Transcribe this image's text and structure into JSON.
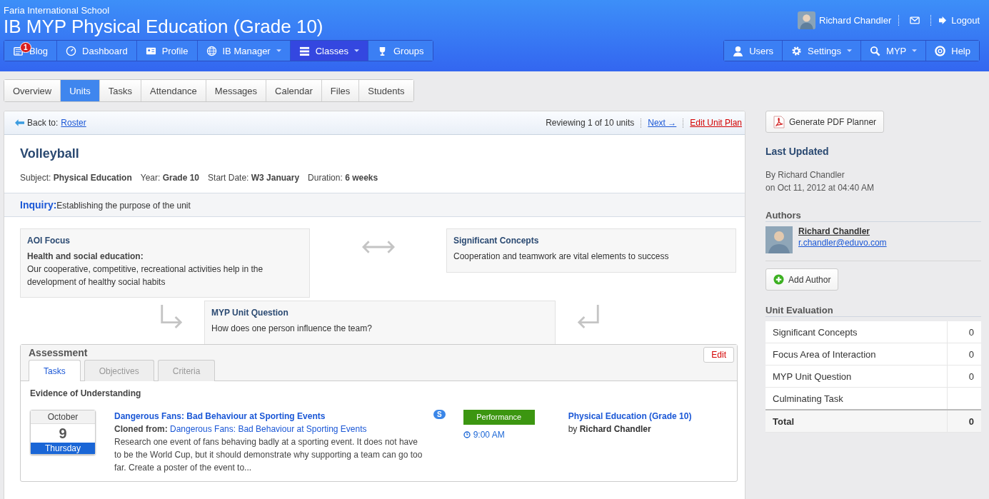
{
  "header": {
    "school": "Faria International School",
    "title": "IB MYP Physical Education (Grade 10)",
    "user": "Richard Chandler",
    "logout": "Logout"
  },
  "nav_left": [
    {
      "label": "Blog",
      "badge": "1",
      "caret": false,
      "selected": false
    },
    {
      "label": "Dashboard",
      "caret": false,
      "selected": false
    },
    {
      "label": "Profile",
      "caret": false,
      "selected": false
    },
    {
      "label": "IB Manager",
      "caret": true,
      "selected": false
    },
    {
      "label": "Classes",
      "caret": true,
      "selected": true
    },
    {
      "label": "Groups",
      "caret": false,
      "selected": false
    }
  ],
  "nav_right": [
    {
      "label": "Users",
      "caret": false
    },
    {
      "label": "Settings",
      "caret": true
    },
    {
      "label": "MYP",
      "caret": true
    },
    {
      "label": "Help",
      "caret": false
    }
  ],
  "tabs": [
    {
      "label": "Overview",
      "selected": false
    },
    {
      "label": "Units",
      "selected": true
    },
    {
      "label": "Tasks",
      "selected": false
    },
    {
      "label": "Attendance",
      "selected": false
    },
    {
      "label": "Messages",
      "selected": false
    },
    {
      "label": "Calendar",
      "selected": false
    },
    {
      "label": "Files",
      "selected": false
    },
    {
      "label": "Students",
      "selected": false
    }
  ],
  "unit": {
    "back_label": "Back to:",
    "back_link": "Roster",
    "reviewing": "Reviewing 1 of 10 units",
    "next": "Next →",
    "edit_plan": "Edit Unit Plan",
    "title": "Volleyball",
    "meta": [
      "Subject: **Physical Education**",
      "Year: **Grade 10**",
      "Start Date: **W3 January**",
      "Duration: **6 weeks**"
    ],
    "inquiry_label": "Inquiry:",
    "inquiry_text": "Establishing the purpose of the unit",
    "aoi": {
      "title": "AOI Focus",
      "subtitle": "Health and social education:",
      "text": "Our cooperative, competitive, recreational activities help in the development of healthy social habits"
    },
    "concepts": {
      "title": "Significant Concepts",
      "text": "Cooperation and teamwork are vital elements to success"
    },
    "question": {
      "title": "MYP Unit Question",
      "text": "How does one person influence the team?"
    }
  },
  "assessment": {
    "title": "Assessment",
    "edit": "Edit",
    "tabs": [
      {
        "label": "Tasks",
        "selected": true
      },
      {
        "label": "Objectives",
        "selected": false
      },
      {
        "label": "Criteria",
        "selected": false
      }
    ],
    "heading": "Evidence of Understanding",
    "tasks": [
      {
        "month": "October",
        "day": "9",
        "weekday": "Thursday",
        "title": "Dangerous Fans: Bad Behaviour at Sporting Events",
        "cloned_label": "Cloned from:",
        "cloned_link": "Dangerous Fans: Bad Behaviour at Sporting Events",
        "description": "Research one event of fans behaving badly at a sporting event. It does not have to be the World Cup, but it should demonstrate why supporting a team can go too far. Create a poster of the event to...",
        "badge": "S",
        "type": "Performance",
        "time": "9:00 AM",
        "class": "Physical Education (Grade 10)",
        "by": "by **Richard Chandler**"
      }
    ]
  },
  "sidebar": {
    "pdf_button": "Generate PDF Planner",
    "updated_title": "Last Updated",
    "updated_by": "By Richard Chandler",
    "updated_on": "on Oct 11, 2012 at 04:40 AM",
    "authors_title": "Authors",
    "authors": [
      {
        "name": "Richard Chandler",
        "email": "r.chandler@eduvo.com"
      }
    ],
    "add_author": "Add Author",
    "evaluation_title": "Unit Evaluation",
    "evaluation": [
      {
        "label": "Significant Concepts",
        "value": "0"
      },
      {
        "label": "Focus Area of Interaction",
        "value": "0"
      },
      {
        "label": "MYP Unit Question",
        "value": "0"
      },
      {
        "label": "Culminating Task"
      }
    ],
    "total": {
      "label": "Total",
      "value": "0"
    }
  }
}
